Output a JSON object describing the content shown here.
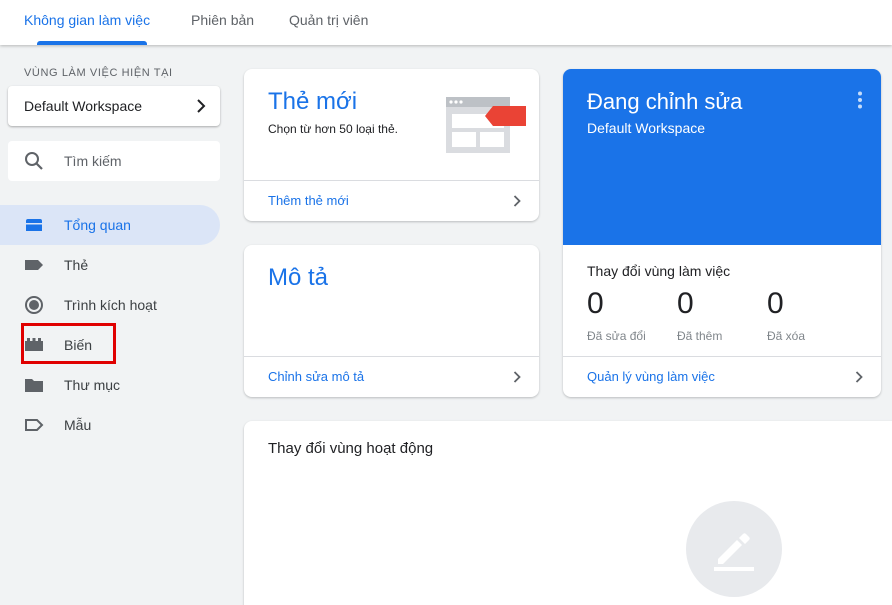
{
  "tabs": [
    {
      "label": "Không gian làm việc",
      "active": true
    },
    {
      "label": "Phiên bản",
      "active": false
    },
    {
      "label": "Quản trị viên",
      "active": false
    }
  ],
  "sidebar": {
    "workspace_label": "VÙNG LÀM VIỆC HIỆN TẠI",
    "workspace_name": "Default Workspace",
    "search_placeholder": "Tìm kiếm",
    "items": [
      {
        "label": "Tổng quan",
        "icon": "overview-icon",
        "active": true
      },
      {
        "label": "Thẻ",
        "icon": "tag-icon",
        "active": false
      },
      {
        "label": "Trình kích hoạt",
        "icon": "trigger-icon",
        "active": false
      },
      {
        "label": "Biến",
        "icon": "variable-icon",
        "active": false,
        "highlighted": true
      },
      {
        "label": "Thư mục",
        "icon": "folder-icon",
        "active": false
      },
      {
        "label": "Mẫu",
        "icon": "template-icon",
        "active": false
      }
    ]
  },
  "cards": {
    "new_tag": {
      "title": "Thẻ mới",
      "subtitle": "Chọn từ hơn 50 loại thẻ.",
      "link": "Thêm thẻ mới"
    },
    "description": {
      "title": "Mô tả",
      "link": "Chỉnh sửa mô tả"
    },
    "editing": {
      "title": "Đang chỉnh sửa",
      "workspace": "Default Workspace",
      "changes_label": "Thay đổi vùng làm việc",
      "stats": [
        {
          "value": "0",
          "label": "Đã sửa đổi"
        },
        {
          "value": "0",
          "label": "Đã thêm"
        },
        {
          "value": "0",
          "label": "Đã xóa"
        }
      ],
      "link": "Quản lý vùng làm việc"
    },
    "activity": {
      "title": "Thay đổi vùng hoạt động"
    }
  },
  "colors": {
    "accent": "#1a73e8",
    "highlight": "#e00000"
  }
}
